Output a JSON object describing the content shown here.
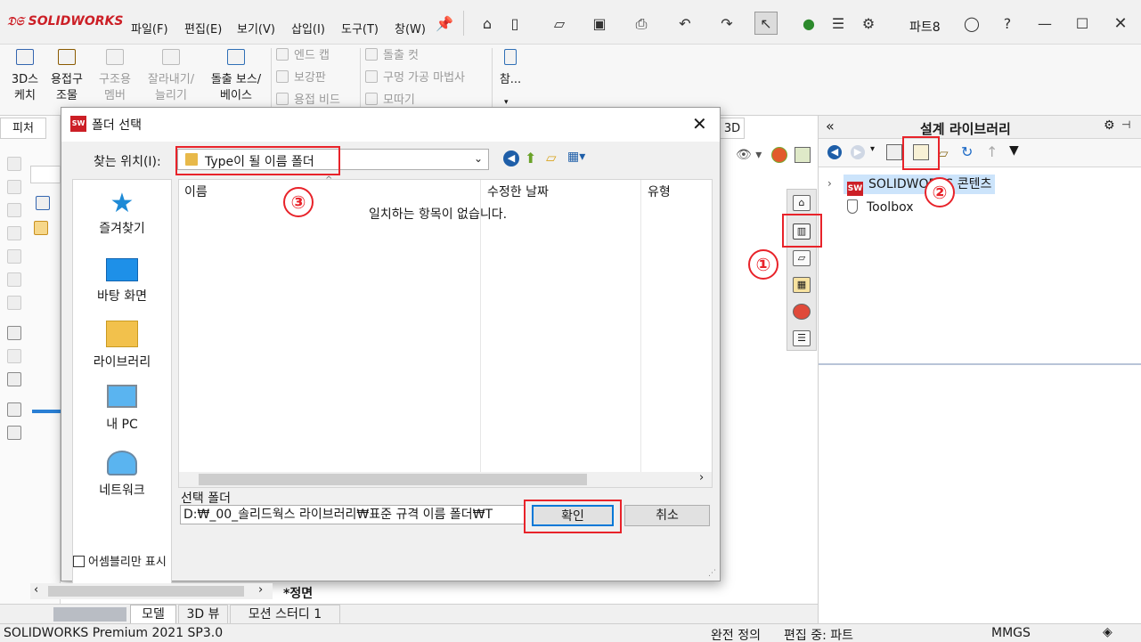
{
  "app": {
    "logo": "SOLIDWORKS",
    "document_name": "파트8"
  },
  "menu": [
    "파일(F)",
    "편집(E)",
    "보기(V)",
    "삽입(I)",
    "도구(T)",
    "창(W)"
  ],
  "ribbon": {
    "items": [
      "3D스\n케치",
      "용접구\n조물",
      "구조용\n멤버",
      "잘라내기/\n늘리기",
      "돌출 보스/\n베이스"
    ],
    "small_items": [
      "엔드 캡",
      "보강판",
      "용접 비드",
      "돌출 컷",
      "구멍 가공 마법사",
      "모따기"
    ],
    "ref_label": "참..."
  },
  "left": {
    "tab_feature": "피처",
    "tab_3d": "3D"
  },
  "dialog": {
    "title": "폴더 선택",
    "look_in_label": "찾는 위치(I):",
    "look_in_value": "Type이 될 이름 폴더",
    "places": [
      "즐겨찾기",
      "바탕 화면",
      "라이브러리",
      "내 PC",
      "네트워크"
    ],
    "columns": [
      "이름",
      "수정한 날짜",
      "유형"
    ],
    "empty_message": "일치하는 항목이 없습니다.",
    "selected_folder_label": "선택 폴더",
    "selected_folder_value": "D:₩_00_솔리드웍스 라이브러리₩표준 규격 이름 폴더₩T",
    "ok_button": "확인",
    "cancel_button": "취소",
    "assembly_only_label": "어셈블리만 표시"
  },
  "design_library": {
    "title": "설계 라이브러리",
    "tree": [
      "SOLIDWORKS 콘텐츠",
      "Toolbox"
    ]
  },
  "annotations": [
    "①",
    "②",
    "③"
  ],
  "view_tabs": [
    "모델",
    "3D 뷰",
    "모션 스터디 1"
  ],
  "view_label": "*정면",
  "status": {
    "product": "SOLIDWORKS Premium 2021 SP3.0",
    "defined": "완전 정의",
    "editing": "편집 중: 파트",
    "units": "MMGS"
  },
  "colors": {
    "annotation": "#e8232a",
    "logo_red": "#cc1f26",
    "accent_blue": "#2a7fd4"
  }
}
